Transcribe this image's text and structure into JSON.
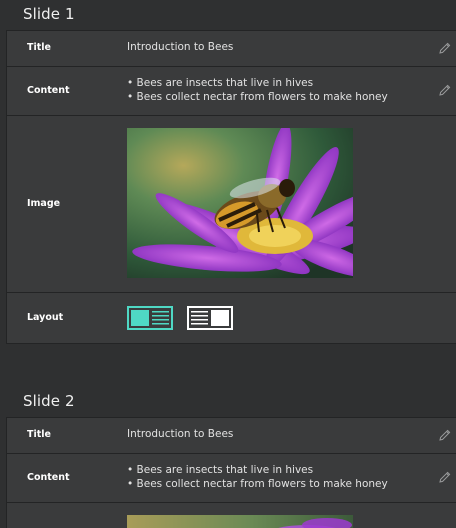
{
  "slides": [
    {
      "heading": "Slide 1",
      "title_label": "Title",
      "title_value": "Introduction to Bees",
      "content_label": "Content",
      "content_lines": [
        "• Bees are insects that live in hives",
        "• Bees collect nectar from flowers to make honey"
      ],
      "image_label": "Image",
      "layout_label": "Layout",
      "layout_selected": "image-left-text-right"
    },
    {
      "heading": "Slide 2",
      "title_label": "Title",
      "title_value": "Introduction to Bees",
      "content_label": "Content",
      "content_lines": [
        "• Bees are insects that live in hives",
        "• Bees collect nectar from flowers to make honey"
      ]
    }
  ],
  "colors": {
    "background": "#2f3031",
    "card": "#3a3b3c",
    "accent": "#4fd8c4"
  },
  "icons": {
    "edit": "pencil-icon"
  }
}
